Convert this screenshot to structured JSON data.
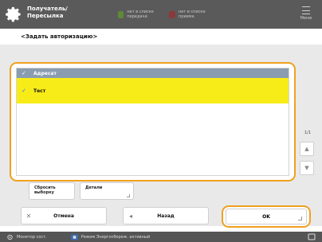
{
  "header": {
    "title_line1": "Получатель/",
    "title_line2": "Пересылка",
    "btn_tx": "нет в списке передачи",
    "btn_rx": "нет в списке приема",
    "menu_label": "Меню"
  },
  "page_heading": "<Задать авторизацию>",
  "list": {
    "header_label": "Адресат",
    "items": [
      {
        "label": "Тест",
        "selected": true
      }
    ]
  },
  "pager": {
    "text": "1/1"
  },
  "options": {
    "clear_label_1": "Сбросить",
    "clear_label_2": "выборку",
    "details_label": "Детали"
  },
  "actions": {
    "cancel_label": "Отмена",
    "back_label": "Назад",
    "ok_label": "OK"
  },
  "statusbar": {
    "monitor_label": "Монитор сост.",
    "power_label": "Режим Энергосбереж. активный"
  },
  "colors": {
    "accent_orange": "#f0a020",
    "selected_yellow": "#f8ec18",
    "header_blue": "#8a9cb0"
  }
}
